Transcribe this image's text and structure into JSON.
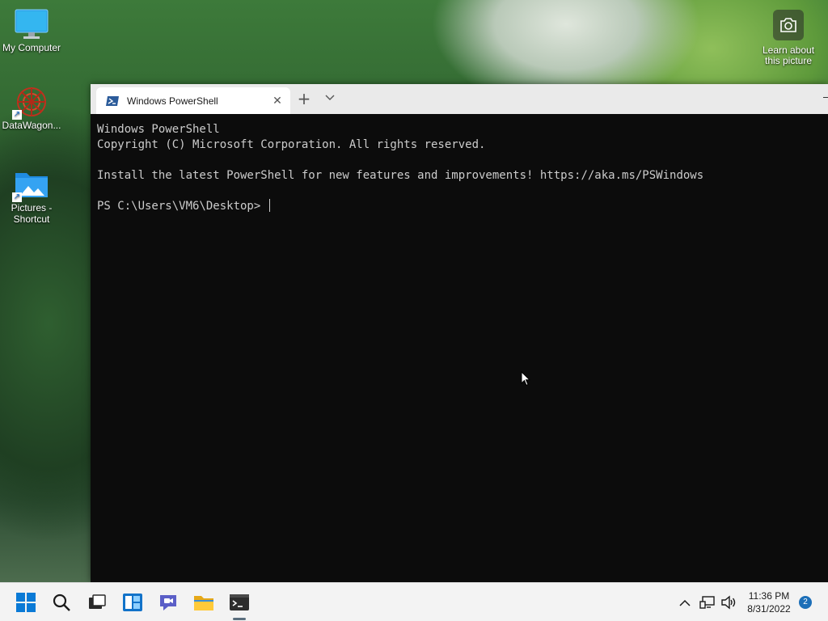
{
  "desktop": {
    "icons": [
      {
        "label": "My Computer"
      },
      {
        "label": "DataWagon..."
      },
      {
        "label": "Pictures -\nShortcut"
      }
    ],
    "learn_about": "Learn about\nthis picture"
  },
  "terminal": {
    "tab_title": "Windows PowerShell",
    "lines": [
      "Windows PowerShell",
      "Copyright (C) Microsoft Corporation. All rights reserved.",
      "",
      "Install the latest PowerShell for new features and improvements! https://aka.ms/PSWindows",
      ""
    ],
    "prompt": "PS C:\\Users\\VM6\\Desktop> "
  },
  "taskbar": {
    "clock_time": "11:36 PM",
    "clock_date": "8/31/2022",
    "notification_count": "2"
  },
  "colors": {
    "accent": "#0078d4",
    "console_bg": "#0c0c0c",
    "console_fg": "#cccccc"
  }
}
